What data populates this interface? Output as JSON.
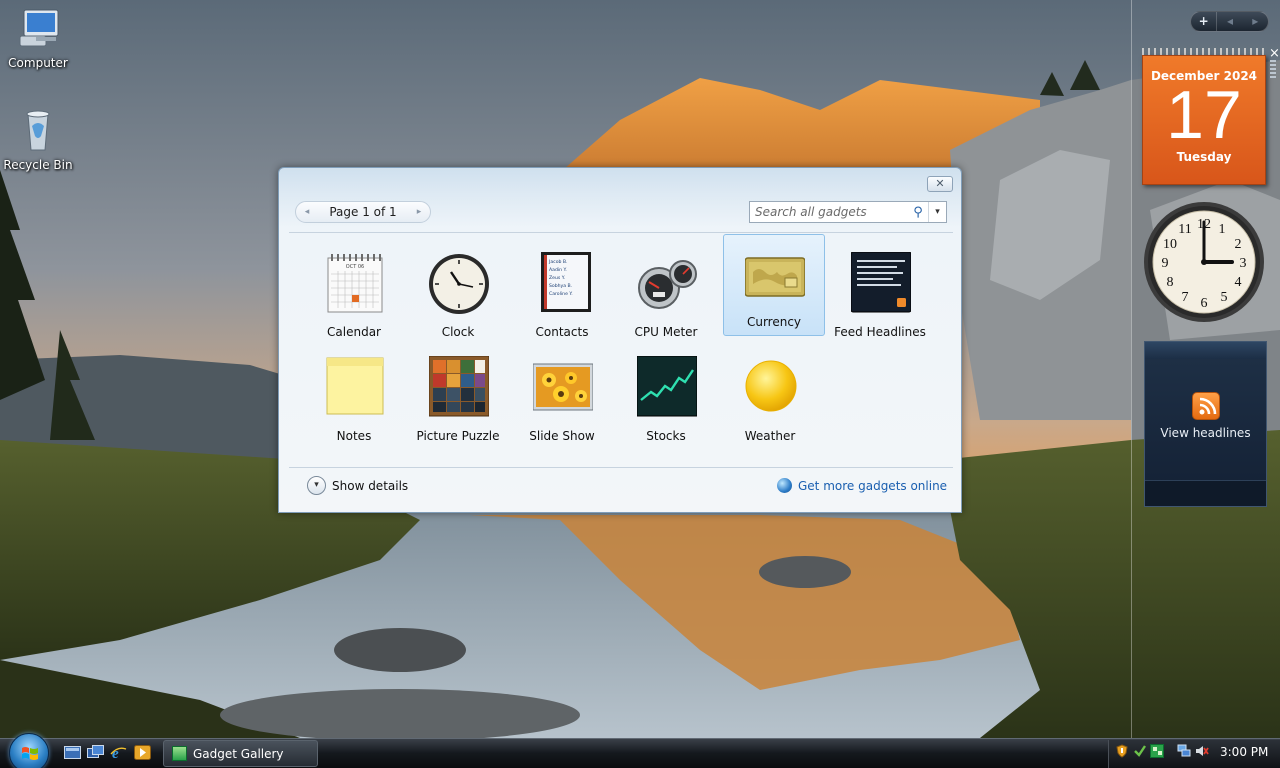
{
  "desktop": {
    "icons": [
      {
        "label": "Computer"
      },
      {
        "label": "Recycle Bin"
      }
    ]
  },
  "sidebar": {
    "nav_add": "+",
    "nav_prev": "◂",
    "nav_next": "▸",
    "close": "×",
    "calendar": {
      "month_year": "December 2024",
      "day": "17",
      "weekday": "Tuesday"
    },
    "clock": {
      "hour": 3,
      "minute": 0
    },
    "headlines": {
      "label": "View headlines"
    }
  },
  "gallery": {
    "close": "✕",
    "pager": {
      "label": "Page 1 of 1",
      "prev": "◂",
      "next": "▸"
    },
    "search": {
      "placeholder": "Search all gadgets",
      "icon": "⚲",
      "dropdown": "▾"
    },
    "gadgets": [
      {
        "label": "Calendar",
        "icon": "calendar-icon"
      },
      {
        "label": "Clock",
        "icon": "clock-icon"
      },
      {
        "label": "Contacts",
        "icon": "contacts-icon"
      },
      {
        "label": "CPU Meter",
        "icon": "cpu-meter-icon"
      },
      {
        "label": "Currency",
        "icon": "currency-icon",
        "selected": true
      },
      {
        "label": "Feed Headlines",
        "icon": "feed-headlines-icon"
      },
      {
        "label": "Notes",
        "icon": "notes-icon"
      },
      {
        "label": "Picture Puzzle",
        "icon": "picture-puzzle-icon"
      },
      {
        "label": "Slide Show",
        "icon": "slide-show-icon"
      },
      {
        "label": "Stocks",
        "icon": "stocks-icon"
      },
      {
        "label": "Weather",
        "icon": "weather-icon"
      }
    ],
    "calendar_icon_month": "OCT 06",
    "contacts_icon_lines": [
      "Jacob B.",
      "Aadin Y.",
      "Zeus Y.",
      "Sobhya B.",
      "Caroline Y."
    ],
    "show_details": "Show details",
    "details_chevron": "▾",
    "get_more": "Get more gadgets online"
  },
  "taskbar": {
    "window_button": "Gadget Gallery",
    "time": "3:00 PM"
  },
  "colors": {
    "calendar_orange": "#e2621f",
    "selection_blue": "#c8e2f8",
    "link_blue": "#1a5fb0",
    "sidebar_navy": "#1a2a3f"
  }
}
